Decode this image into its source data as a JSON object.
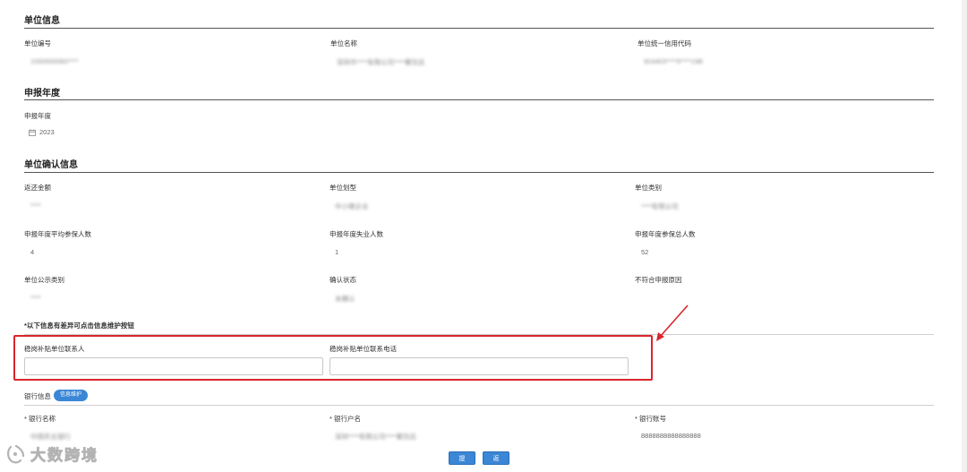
{
  "sections": {
    "unit_info": "单位信息",
    "declare_year": "申报年度",
    "confirm_info": "单位确认信息"
  },
  "unit_info": {
    "unit_no_label": "单位编号",
    "unit_no_value": "1000500083****",
    "unit_name_label": "单位名称",
    "unit_name_value": "深圳市****有限公司****餐饮店",
    "credit_code_label": "单位统一信用代码",
    "credit_code_value": "924403****5****19B"
  },
  "declare_year": {
    "label": "申报年度",
    "value": "2023",
    "icon": "calendar-icon"
  },
  "confirm_info": {
    "refund_label": "返还金额",
    "refund_value": "****",
    "scale_label": "单位划型",
    "scale_value": "中小微企业",
    "category_label": "单位类别",
    "category_value": "****有限公司",
    "avg_insured_label": "申报年度平均参保人数",
    "avg_insured_value": "4",
    "unemployed_label": "申报年度失业人数",
    "unemployed_value": "1",
    "total_insured_label": "申报年度参保总人数",
    "total_insured_value": "52",
    "public_category_label": "单位公示类别",
    "public_category_value": "****",
    "status_label": "确认状态",
    "status_value": "未确认",
    "reason_label": "不符合申报原因",
    "reason_value": ""
  },
  "hint": "*以下信息有差异可点击信息维护按钮",
  "contact": {
    "person_label": "稳岗补贴单位联系人",
    "person_value": "",
    "phone_label": "稳岗补贴单位联系电话",
    "phone_value": ""
  },
  "bank": {
    "section_label": "银行信息",
    "button_label": "信息维护",
    "bank_name_label": "* 银行名称",
    "bank_name_value": "中国农业银行",
    "account_name_label": "* 银行户名",
    "account_name_value": "深圳****有限公司****餐饮店",
    "account_no_label": "* 银行账号",
    "account_no_value": "8888888888888888"
  },
  "actions": {
    "submit": "提交",
    "back": "返回"
  },
  "watermark": "大数跨境",
  "colors": {
    "accent": "#3b86d6",
    "highlight": "#d9252b"
  }
}
